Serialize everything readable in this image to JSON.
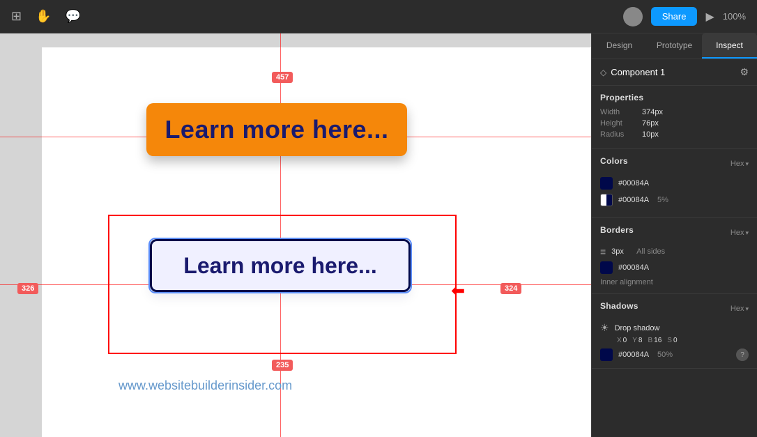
{
  "topbar": {
    "zoom_label": "100%",
    "share_label": "Share",
    "avatar_alt": "user avatar"
  },
  "panel_tabs": {
    "design_label": "Design",
    "prototype_label": "Prototype",
    "inspect_label": "Inspect"
  },
  "component": {
    "name": "Component 1"
  },
  "properties": {
    "title": "Properties",
    "width_label": "Width",
    "width_value": "374px",
    "height_label": "Height",
    "height_value": "76px",
    "radius_label": "Radius",
    "radius_value": "10px"
  },
  "colors": {
    "title": "Colors",
    "hex_label": "Hex",
    "color1_hex": "#00084A",
    "color2_hex": "#00084A",
    "color2_opacity": "5%"
  },
  "borders": {
    "title": "Borders",
    "hex_label": "Hex",
    "size": "3px",
    "sides": "All sides",
    "color_hex": "#00084A",
    "alignment": "Inner alignment"
  },
  "shadows": {
    "title": "Shadows",
    "hex_label": "Hex",
    "type": "Drop shadow",
    "x_label": "X",
    "x_value": "0",
    "y_label": "Y",
    "y_value": "8",
    "b_label": "B",
    "b_value": "16",
    "s_label": "S",
    "s_value": "0",
    "color_hex": "#00084A",
    "color_opacity": "50%"
  },
  "canvas": {
    "orange_btn_text": "Learn more here...",
    "white_btn_text": "Learn more here...",
    "website_text": "www.websitebuilderinsider.com",
    "dist_top": "457",
    "dist_left": "326",
    "dist_right": "324",
    "dist_bottom": "235"
  }
}
